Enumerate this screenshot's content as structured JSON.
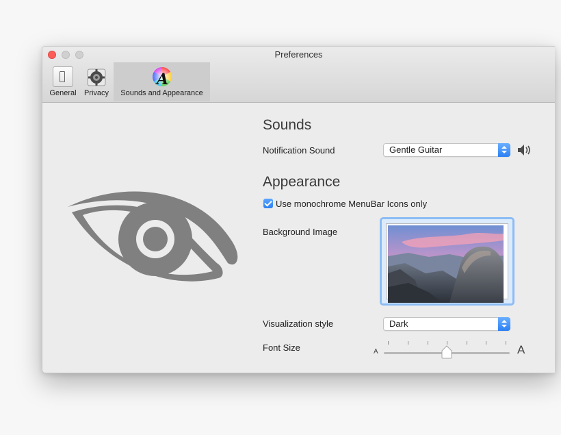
{
  "window": {
    "title": "Preferences"
  },
  "toolbar": {
    "items": [
      {
        "label": "General",
        "icon": "general-switch-icon"
      },
      {
        "label": "Privacy",
        "icon": "privacy-gear-icon"
      },
      {
        "label": "Sounds and Appearance",
        "icon": "color-wheel-letter-a-icon",
        "selected": true
      }
    ]
  },
  "sounds": {
    "heading": "Sounds",
    "notification_label": "Notification Sound",
    "notification_value": "Gentle Guitar",
    "speaker_icon": "speaker-icon"
  },
  "appearance": {
    "heading": "Appearance",
    "monochrome_label": "Use monochrome MenuBar Icons only",
    "monochrome_checked": true,
    "background_label": "Background Image",
    "visualization_label": "Visualization style",
    "visualization_value": "Dark",
    "font_size_label": "Font Size",
    "font_small_glyph": "A",
    "font_large_glyph": "A",
    "font_size_level": 0.5
  },
  "colors": {
    "accent": "#2d80f1",
    "eye_logo": "#808080",
    "close_button": "#fc5e57"
  }
}
